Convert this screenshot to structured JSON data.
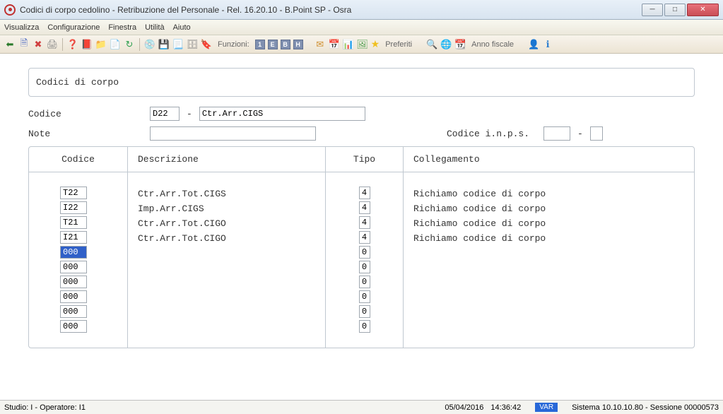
{
  "window": {
    "title": "Codici di corpo cedolino - Retribuzione del Personale - Rel. 16.20.10 - B.Point SP - Osra"
  },
  "menu": {
    "items": [
      "Visualizza",
      "Configurazione",
      "Finestra",
      "Utilità",
      "Aiuto"
    ]
  },
  "toolbar": {
    "functions_label": "Funzioni:",
    "favorites_label": "Preferiti",
    "fiscal_year_label": "Anno fiscale"
  },
  "section": {
    "title": "Codici di corpo",
    "code_label": "Codice",
    "code_value": "D22",
    "code_desc": "Ctr.Arr.CIGS",
    "note_label": "Note",
    "note_value": "",
    "inps_label": "Codice i.n.p.s.",
    "inps_value": "",
    "inps_suffix": ""
  },
  "grid": {
    "headers": {
      "code": "Codice",
      "desc": "Descrizione",
      "type": "Tipo",
      "link": "Collegamento"
    },
    "rows": [
      {
        "code": "T22",
        "desc": "Ctr.Arr.Tot.CIGS",
        "type": "4",
        "link": "Richiamo codice di corpo",
        "selected": false
      },
      {
        "code": "I22",
        "desc": "Imp.Arr.CIGS",
        "type": "4",
        "link": "Richiamo codice di corpo",
        "selected": false
      },
      {
        "code": "T21",
        "desc": "Ctr.Arr.Tot.CIGO",
        "type": "4",
        "link": "Richiamo codice di corpo",
        "selected": false
      },
      {
        "code": "I21",
        "desc": "Ctr.Arr.Tot.CIGO",
        "type": "4",
        "link": "Richiamo codice di corpo",
        "selected": false
      },
      {
        "code": "000",
        "desc": "",
        "type": "0",
        "link": "",
        "selected": true
      },
      {
        "code": "000",
        "desc": "",
        "type": "0",
        "link": "",
        "selected": false
      },
      {
        "code": "000",
        "desc": "",
        "type": "0",
        "link": "",
        "selected": false
      },
      {
        "code": "000",
        "desc": "",
        "type": "0",
        "link": "",
        "selected": false
      },
      {
        "code": "000",
        "desc": "",
        "type": "0",
        "link": "",
        "selected": false
      },
      {
        "code": "000",
        "desc": "",
        "type": "0",
        "link": "",
        "selected": false
      }
    ]
  },
  "status": {
    "left": "Studio: I - Operatore: I1",
    "date": "05/04/2016",
    "time": "14:36:42",
    "badge": "VAR",
    "right": "Sistema 10.10.10.80 - Sessione 00000573"
  }
}
